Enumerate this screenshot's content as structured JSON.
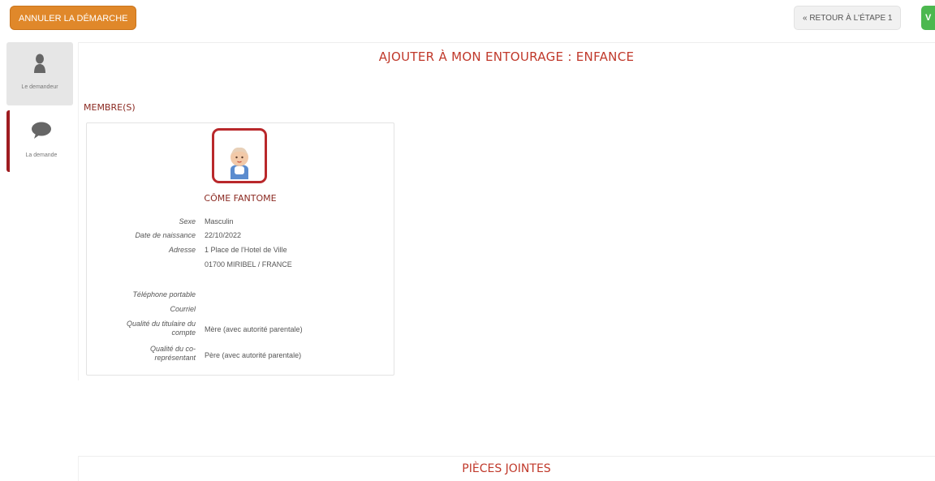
{
  "header": {
    "cancel_label": "ANNULER LA DÉMARCHE",
    "back_label": "« RETOUR À L'ÉTAPE 1",
    "next_label": "V"
  },
  "sidebar": {
    "items": [
      {
        "label": "Le demandeur",
        "icon": "person-icon"
      },
      {
        "label": "La demande",
        "icon": "chat-bubble-icon"
      }
    ]
  },
  "page": {
    "title": "AJOUTER À MON ENTOURAGE : ENFANCE",
    "section_label": "MEMBRE(S)"
  },
  "member": {
    "name": "CÔME FANTOME",
    "fields": {
      "sexe_label": "Sexe",
      "sexe_value": "Masculin",
      "naissance_label": "Date de naissance",
      "naissance_value": "22/10/2022",
      "adresse_label": "Adresse",
      "adresse_line1": "1 Place de l'Hotel de Ville",
      "adresse_line2": "01700 MIRIBEL / FRANCE",
      "telephone_label": "Téléphone portable",
      "courriel_label": "Courriel",
      "titulaire_label_1": "Qualité du titulaire du",
      "titulaire_label_2": "compte",
      "titulaire_value": "Mère (avec autorité parentale)",
      "corep_label_1": "Qualité du co-",
      "corep_label_2": "représentant",
      "corep_value": "Père (avec autorité parentale)"
    }
  },
  "attachments": {
    "title": "PIÈCES JOINTES"
  },
  "colors": {
    "accent_red": "#c0392b",
    "cancel_orange": "#e0882a",
    "next_green": "#4cb84f"
  }
}
